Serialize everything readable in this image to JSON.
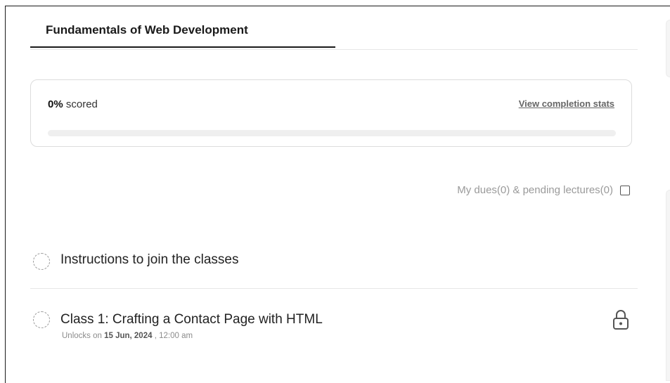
{
  "tabs": [
    {
      "label": "Fundamentals of Web Development",
      "active": true
    }
  ],
  "score": {
    "value": "0%",
    "suffix": "scored",
    "progress_percent": 0,
    "view_stats_label": "View completion stats"
  },
  "filter": {
    "label": "My dues(0) & pending lectures(0)",
    "checked": false
  },
  "lectures": [
    {
      "title": "Instructions to join the classes",
      "status_icon": "dashed-circle-icon",
      "locked": false
    },
    {
      "title": "Class 1: Crafting a Contact Page with HTML",
      "status_icon": "dashed-circle-icon",
      "unlock_prefix": "Unlocks on",
      "unlock_date": "15 Jun, 2024",
      "unlock_time": ", 12:00 am",
      "locked": true,
      "lock_icon": "lock-icon"
    }
  ],
  "colors": {
    "progress": "#4a7cff",
    "accent_text": "#1a1a1a"
  }
}
